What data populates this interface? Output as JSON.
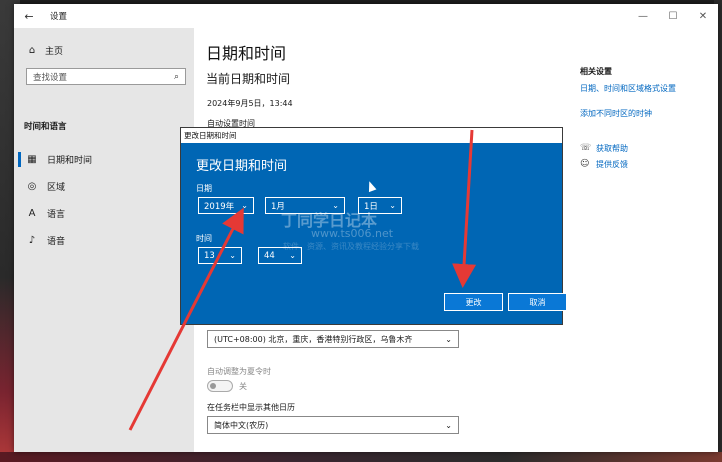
{
  "window": {
    "title": "设置",
    "back": "←",
    "controls": [
      "—",
      "☐",
      "✕"
    ]
  },
  "sidebar": {
    "home": "主页",
    "search_placeholder": "查找设置",
    "section": "时间和语言",
    "items": [
      {
        "label": "日期和时间",
        "icon": "calendar-icon",
        "active": true
      },
      {
        "label": "区域",
        "icon": "globe-icon",
        "active": false
      },
      {
        "label": "语言",
        "icon": "language-icon",
        "active": false
      },
      {
        "label": "语音",
        "icon": "microphone-icon",
        "active": false
      }
    ]
  },
  "content": {
    "page_title": "日期和时间",
    "section_title": "当前日期和时间",
    "current_datetime": "2024年9月5日，13:44",
    "auto_time_label": "自动设置时间",
    "timezone_value": "(UTC+08:00) 北京，重庆，香港特别行政区，乌鲁木齐",
    "dst_label": "自动调整为夏令时",
    "dst_toggle_text": "关",
    "calendar_label": "在任务栏中显示其他日历",
    "calendar_value": "简体中文(农历)"
  },
  "related": {
    "heading": "相关设置",
    "links": [
      "日期、时间和区域格式设置",
      "添加不同时区的时钟"
    ],
    "help": [
      {
        "label": "获取帮助",
        "icon": "help-chat-icon"
      },
      {
        "label": "提供反馈",
        "icon": "feedback-icon"
      }
    ]
  },
  "dialog": {
    "window_title": "更改日期和时间",
    "heading": "更改日期和时间",
    "date_label": "日期",
    "year": "2019年",
    "month": "1月",
    "day": "1日",
    "time_label": "时间",
    "hour": "13",
    "minute": "44",
    "ok_label": "更改",
    "cancel_label": "取消",
    "watermark_title": "丁同学日记本",
    "watermark_url": "www.ts006.net",
    "watermark_desc": "软件、资源、资讯及教程经验分享下载"
  },
  "colors": {
    "dialog_blue": "#0066b4",
    "link_blue": "#0067c0",
    "annotation_red": "#e53935"
  }
}
